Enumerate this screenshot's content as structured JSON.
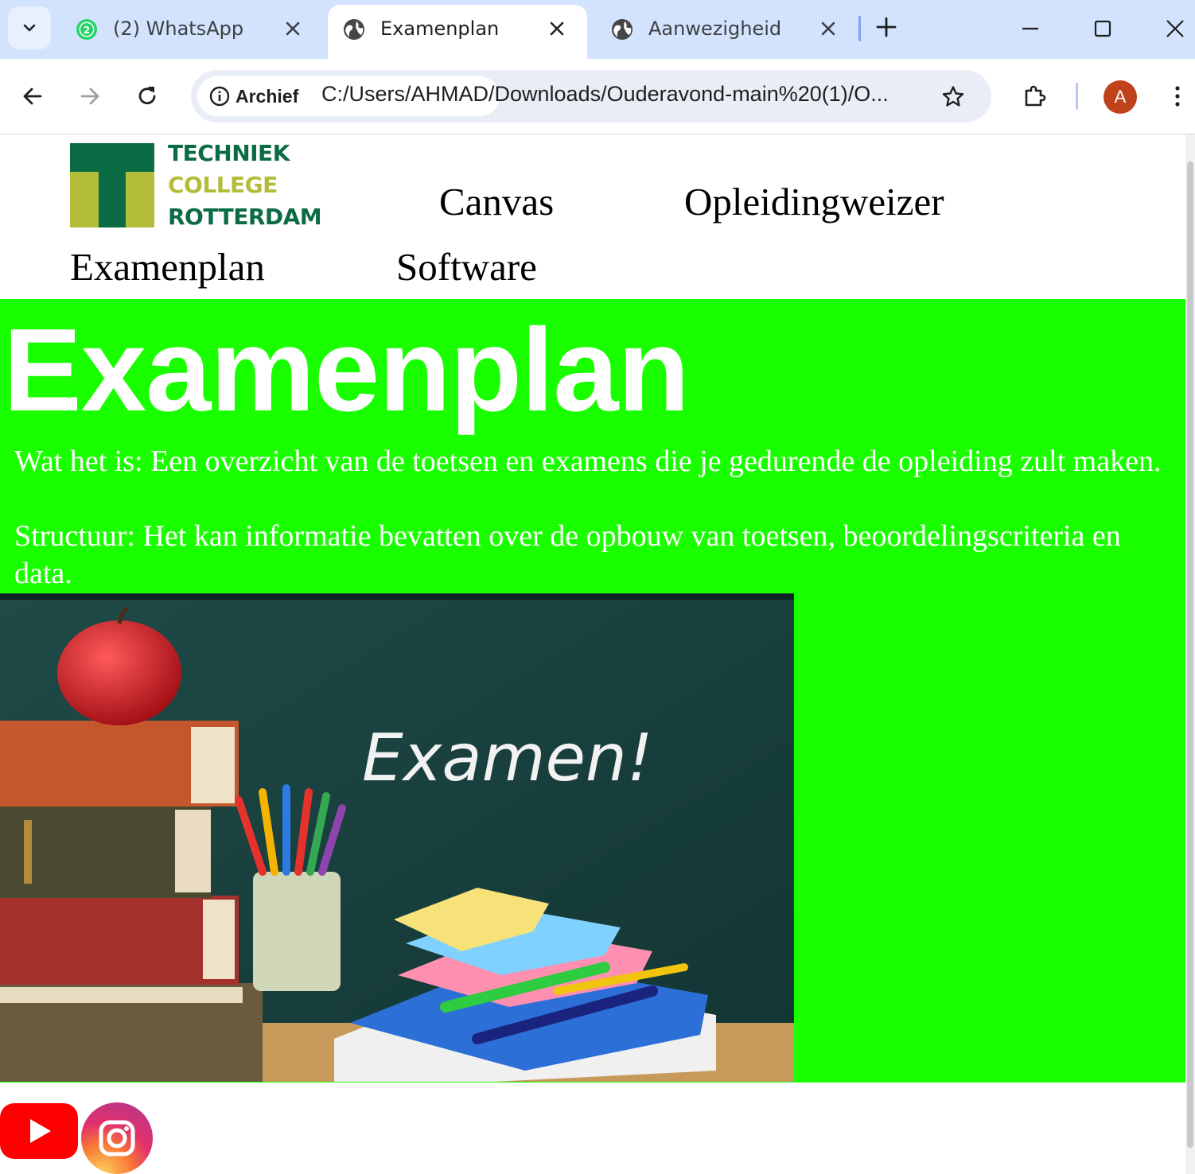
{
  "browser": {
    "tabs": [
      {
        "title": "(2) WhatsApp",
        "badge": "2",
        "favicon": "whatsapp-icon",
        "active": false
      },
      {
        "title": "Examenplan",
        "favicon": "globe-icon",
        "active": true
      },
      {
        "title": "Aanwezigheid",
        "favicon": "globe-icon",
        "active": false
      }
    ],
    "address": {
      "chip_label": "Archief",
      "url": "C:/Users/AHMAD/Downloads/Ouderavond-main%20(1)/O..."
    },
    "profile_initial": "A",
    "colors": {
      "tabstrip": "#d3e3fd",
      "omnibox": "#e9eef6",
      "avatar": "#c0421a"
    }
  },
  "page": {
    "logo": {
      "line1": "TECHNIEK",
      "line2": "COLLEGE",
      "line3": "ROTTERDAM"
    },
    "nav": {
      "canvas": "Canvas",
      "opleidingweizer": "Opleidingweizer",
      "examenplan": "Examenplan",
      "software": "Software"
    },
    "hero": {
      "title": "Examenplan",
      "line1": "Wat het is: Een overzicht van de toetsen en examens die je gedurende de opleiding zult maken.",
      "line2": "Structuur: Het kan informatie bevatten over de opbouw van toetsen, beoordelingscriteria en data.",
      "image_caption": "Examen!",
      "background": "#1aff00"
    },
    "social": [
      "youtube-icon",
      "instagram-icon"
    ],
    "colors": {
      "logo_green": "#0b6b45",
      "logo_lime": "#b4bd3a"
    }
  }
}
